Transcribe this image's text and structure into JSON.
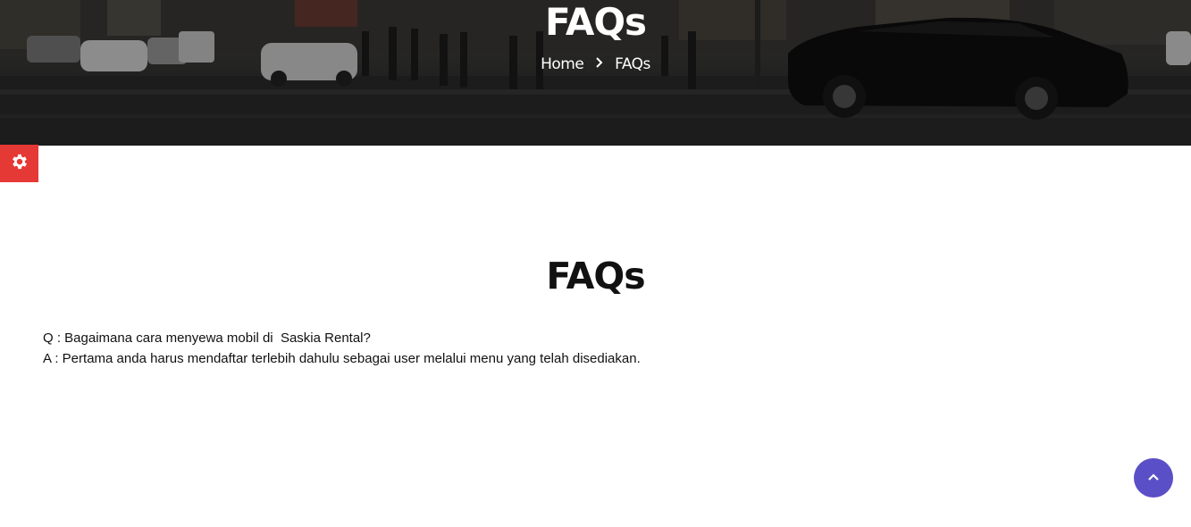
{
  "hero": {
    "title": "FAQs",
    "breadcrumb": {
      "home": "Home",
      "separator_icon": "chevron-right-icon",
      "current": "FAQs"
    }
  },
  "settings_tab": {
    "icon": "gear-icon",
    "color": "#e53935"
  },
  "main": {
    "title": "FAQs",
    "faqs": [
      {
        "question": "Q : Bagaimana cara menyewa mobil di  Saskia Rental?",
        "answer": "A : Pertama anda harus mendaftar terlebih dahulu sebagai user melalui menu yang telah disediakan."
      }
    ]
  },
  "back_to_top": {
    "icon": "chevron-up-icon",
    "color": "#5b4fc7"
  }
}
